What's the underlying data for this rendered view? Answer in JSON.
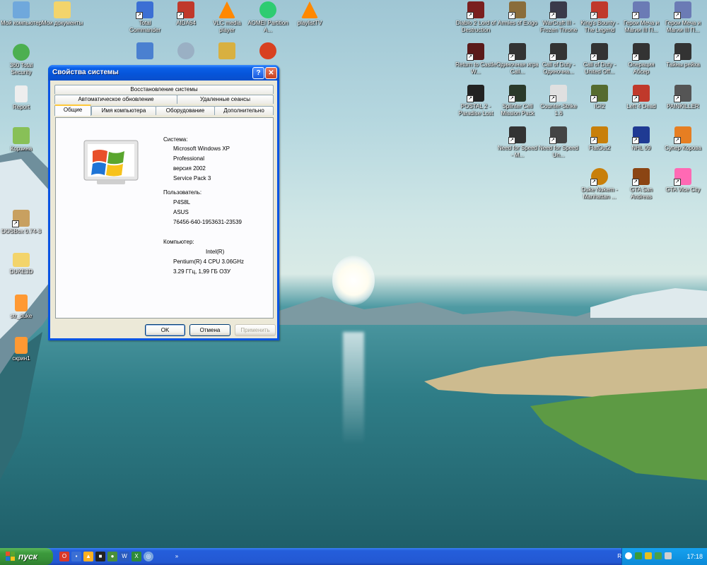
{
  "desktop": {
    "left_icons": [
      {
        "label": "Мой компьютер",
        "icon": "my-computer-icon",
        "color": "#6fa8dc"
      },
      {
        "label": "Мои документы",
        "icon": "my-documents-icon",
        "color": "#f3d46b"
      },
      {
        "label": "360 Total Security",
        "icon": "security-icon",
        "color": "#4caf50"
      },
      {
        "label": "Report",
        "icon": "report-icon",
        "color": "#eeeeee"
      },
      {
        "label": "Корзина",
        "icon": "recycle-bin-icon",
        "color": "#88c057"
      },
      {
        "label": "DOSBox 0.74-3",
        "icon": "dosbox-icon",
        "color": "#c8a060"
      },
      {
        "label": "DUKE3D",
        "icon": "folder-icon",
        "color": "#f3d46b"
      },
      {
        "label": "str_duke",
        "icon": "document-icon",
        "color": "#ff9933"
      },
      {
        "label": "скрин1",
        "icon": "image-icon",
        "color": "#ff9933"
      }
    ],
    "top_icons": [
      {
        "label": "Total Commander",
        "icon": "total-commander-icon",
        "color": "#3b6fd4"
      },
      {
        "label": "AIDA64",
        "icon": "aida64-icon",
        "color": "#c0392b"
      },
      {
        "label": "VLC media player",
        "icon": "vlc-icon",
        "color": "#ff8800"
      },
      {
        "label": "AOMEI Partition A...",
        "icon": "aomei-icon",
        "color": "#2ecc71"
      },
      {
        "label": "playlistTV",
        "icon": "vlc-icon",
        "color": "#ff8800"
      }
    ],
    "game_icons": [
      {
        "label": "Diablo 2 Lord of Destruction",
        "icon": "diablo-icon",
        "color": "#7a1f1f"
      },
      {
        "label": "Armies of Exigo",
        "icon": "exigo-icon",
        "color": "#8a6d3b"
      },
      {
        "label": "WarCraft III - Frozen Throne",
        "icon": "warcraft-icon",
        "color": "#3a3a4a"
      },
      {
        "label": "King's Bounty - The Legend",
        "icon": "kings-bounty-icon",
        "color": "#c0392b"
      },
      {
        "label": "Герои Меча и Магии III П...",
        "icon": "heroes-icon",
        "color": "#6b7bb5"
      },
      {
        "label": "Герои Меча и Магии III П...",
        "icon": "heroes-icon",
        "color": "#6b7bb5"
      },
      {
        "label": "Return to Castle W...",
        "icon": "rtcw-icon",
        "color": "#5a1a1a"
      },
      {
        "label": "Одиночная игра Call...",
        "icon": "cod2-icon",
        "color": "#333333"
      },
      {
        "label": "Call of Duty - Одиночна...",
        "icon": "cod-icon",
        "color": "#333333"
      },
      {
        "label": "Call of Duty - United Off...",
        "icon": "cod-icon",
        "color": "#333333"
      },
      {
        "label": "Операция Абсер",
        "icon": "cod-icon",
        "color": "#333333"
      },
      {
        "label": "Тайны рейха",
        "icon": "cod-icon",
        "color": "#333333"
      },
      {
        "label": "POSTAL 2 - Paradise Lost",
        "icon": "postal-icon",
        "color": "#222222"
      },
      {
        "label": "Splinter Cell Mission Pack",
        "icon": "splinter-cell-icon",
        "color": "#2a3a2a"
      },
      {
        "label": "Counter-Strike 1.6",
        "icon": "counter-strike-icon",
        "color": "#e0e0e0"
      },
      {
        "label": "IGI2",
        "icon": "igi2-icon",
        "color": "#556b2f"
      },
      {
        "label": "Left 4 Dead",
        "icon": "left4dead-icon",
        "color": "#c0392b"
      },
      {
        "label": "PAINKILLER",
        "icon": "painkiller-icon",
        "color": "#555555"
      },
      {
        "label": "Need for Speed - M...",
        "icon": "nfs-mw-icon",
        "color": "#333333"
      },
      {
        "label": "Need for Speed Un...",
        "icon": "nfs-u-icon",
        "color": "#444444"
      },
      {
        "label": "FlatOut2",
        "icon": "flatout-icon",
        "color": "#c87f0a"
      },
      {
        "label": "NHL 09",
        "icon": "nhl-icon",
        "color": "#1f3a93"
      },
      {
        "label": "Супер Корова",
        "icon": "super-cow-icon",
        "color": "#e67e22"
      },
      {
        "label": "Duke Nukem - Manhattan ...",
        "icon": "duke-nukem-icon",
        "color": "#c87f0a"
      },
      {
        "label": "GTA San Andreas",
        "icon": "gta-sa-icon",
        "color": "#8b4513"
      },
      {
        "label": "GTA Vice City",
        "icon": "gta-vc-icon",
        "color": "#ff69b4"
      }
    ]
  },
  "dialog": {
    "title": "Свойства системы",
    "help_label": "?",
    "close_label": "✕",
    "tabs_row1": [
      "Восстановление системы"
    ],
    "tabs_row2": [
      "Автоматическое обновление",
      "Удаленные сеансы"
    ],
    "tabs_row3": [
      "Общие",
      "Имя компьютера",
      "Оборудование",
      "Дополнительно"
    ],
    "system_label": "Система:",
    "system_lines": [
      "Microsoft Windows XP",
      "Professional",
      "версия 2002",
      "Service Pack 3"
    ],
    "user_label": "Пользователь:",
    "user_lines": [
      "P4S8L",
      "ASUS",
      "76456-640-1953631-23539"
    ],
    "computer_label": "Компьютер:",
    "computer_lines": [
      "Intel(R)",
      "Pentium(R) 4 CPU 3.06GHz",
      "3.29 ГГц, 1,99 ГБ ОЗУ"
    ],
    "ok_label": "OK",
    "cancel_label": "Отмена",
    "apply_label": "Применить"
  },
  "taskbar": {
    "start_label": "пуск",
    "chevron": "»",
    "language": "RU",
    "clock": "17:18"
  },
  "colors": {
    "titlebar": "#0a54e3",
    "start": "#3c9a3c",
    "tray": "#0c8ad8"
  }
}
